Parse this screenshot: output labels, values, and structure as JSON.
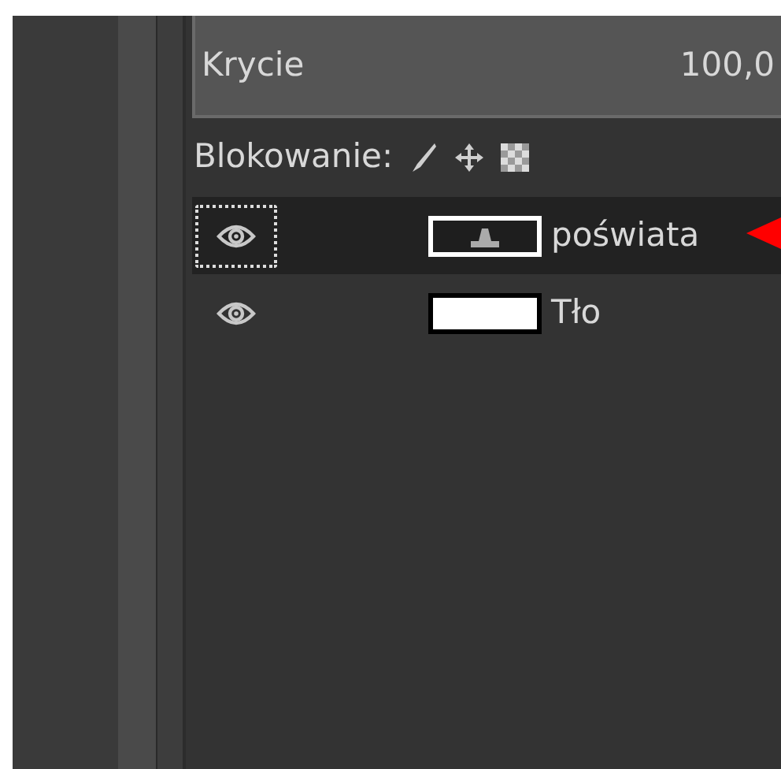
{
  "opacity": {
    "label": "Krycie",
    "value": "100,0",
    "level": 1
  },
  "lock": {
    "label": "Blokowanie:"
  },
  "layers": [
    {
      "name": "poświata",
      "visible": true,
      "selected": true,
      "kind": "text"
    },
    {
      "name": "Tło",
      "visible": true,
      "selected": false,
      "kind": "fill"
    }
  ]
}
